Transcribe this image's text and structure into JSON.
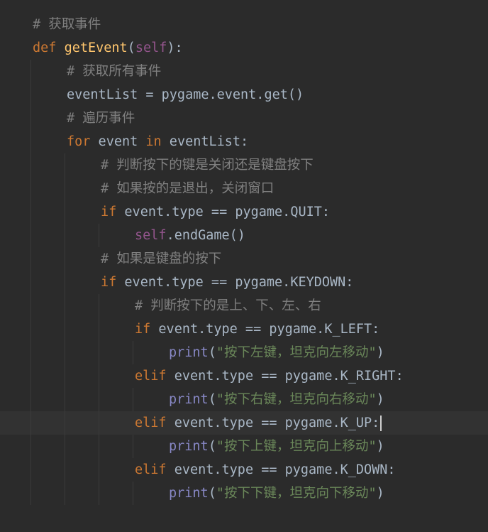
{
  "editor": {
    "language": "python",
    "colors": {
      "background": "#2b2b2b",
      "current_line": "#323232",
      "default": "#a9b7c6",
      "keyword": "#cc7832",
      "function": "#ffc66d",
      "self": "#94558d",
      "builtin": "#8888c6",
      "comment": "#808080",
      "string": "#6a8759",
      "indent_guide": "#3b3b3b"
    },
    "current_line_index": 17,
    "lines": [
      {
        "indent": 0,
        "segments": [
          {
            "t": "# 获取事件",
            "c": "comment"
          }
        ]
      },
      {
        "indent": 0,
        "segments": [
          {
            "t": "def",
            "c": "keyword"
          },
          {
            "t": " ",
            "c": "default"
          },
          {
            "t": "getEvent",
            "c": "function"
          },
          {
            "t": "(",
            "c": "default"
          },
          {
            "t": "self",
            "c": "self"
          },
          {
            "t": "):",
            "c": "default"
          }
        ]
      },
      {
        "indent": 1,
        "segments": [
          {
            "t": "# 获取所有事件",
            "c": "comment"
          }
        ]
      },
      {
        "indent": 1,
        "segments": [
          {
            "t": "eventList = pygame.event.get()",
            "c": "default"
          }
        ]
      },
      {
        "indent": 1,
        "segments": [
          {
            "t": "# 遍历事件",
            "c": "comment"
          }
        ]
      },
      {
        "indent": 1,
        "segments": [
          {
            "t": "for",
            "c": "keyword"
          },
          {
            "t": " event ",
            "c": "default"
          },
          {
            "t": "in",
            "c": "keyword"
          },
          {
            "t": " eventList:",
            "c": "default"
          }
        ]
      },
      {
        "indent": 2,
        "segments": [
          {
            "t": "# 判断按下的键是关闭还是键盘按下",
            "c": "comment"
          }
        ]
      },
      {
        "indent": 2,
        "segments": [
          {
            "t": "# 如果按的是退出，关闭窗口",
            "c": "comment"
          }
        ]
      },
      {
        "indent": 2,
        "segments": [
          {
            "t": "if",
            "c": "keyword"
          },
          {
            "t": " event.type == pygame.QUIT:",
            "c": "default"
          }
        ]
      },
      {
        "indent": 3,
        "segments": [
          {
            "t": "self",
            "c": "self"
          },
          {
            "t": ".endGame()",
            "c": "default"
          }
        ]
      },
      {
        "indent": 2,
        "segments": [
          {
            "t": "# 如果是键盘的按下",
            "c": "comment"
          }
        ]
      },
      {
        "indent": 2,
        "segments": [
          {
            "t": "if",
            "c": "keyword"
          },
          {
            "t": " event.type == pygame.KEYDOWN:",
            "c": "default"
          }
        ]
      },
      {
        "indent": 3,
        "segments": [
          {
            "t": "# 判断按下的是上、下、左、右",
            "c": "comment"
          }
        ]
      },
      {
        "indent": 3,
        "segments": [
          {
            "t": "if",
            "c": "keyword"
          },
          {
            "t": " event.type == pygame.K_LEFT:",
            "c": "default"
          }
        ]
      },
      {
        "indent": 4,
        "segments": [
          {
            "t": "print",
            "c": "builtin"
          },
          {
            "t": "(",
            "c": "default"
          },
          {
            "t": "\"按下左键，坦克向左移动\"",
            "c": "string"
          },
          {
            "t": ")",
            "c": "default"
          }
        ]
      },
      {
        "indent": 3,
        "segments": [
          {
            "t": "elif",
            "c": "keyword"
          },
          {
            "t": " event.type == pygame.K_RIGHT:",
            "c": "default"
          }
        ]
      },
      {
        "indent": 4,
        "segments": [
          {
            "t": "print",
            "c": "builtin"
          },
          {
            "t": "(",
            "c": "default"
          },
          {
            "t": "\"按下右键，坦克向右移动\"",
            "c": "string"
          },
          {
            "t": ")",
            "c": "default"
          }
        ]
      },
      {
        "indent": 3,
        "segments": [
          {
            "t": "elif",
            "c": "keyword"
          },
          {
            "t": " event.type == pygame.K_UP:",
            "c": "default"
          }
        ]
      },
      {
        "indent": 4,
        "segments": [
          {
            "t": "print",
            "c": "builtin"
          },
          {
            "t": "(",
            "c": "default"
          },
          {
            "t": "\"按下上键，坦克向上移动\"",
            "c": "string"
          },
          {
            "t": ")",
            "c": "default"
          }
        ]
      },
      {
        "indent": 3,
        "segments": [
          {
            "t": "elif",
            "c": "keyword"
          },
          {
            "t": " event.type == pygame.K_DOWN:",
            "c": "default"
          }
        ]
      },
      {
        "indent": 4,
        "segments": [
          {
            "t": "print",
            "c": "builtin"
          },
          {
            "t": "(",
            "c": "default"
          },
          {
            "t": "\"按下下键，坦克向下移动\"",
            "c": "string"
          },
          {
            "t": ")",
            "c": "default"
          }
        ]
      }
    ]
  }
}
